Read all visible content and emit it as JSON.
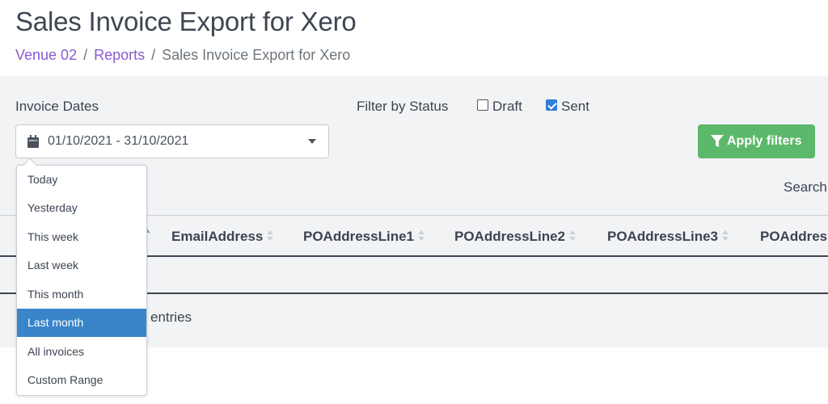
{
  "header": {
    "title": "Sales Invoice Export for Xero",
    "breadcrumb": [
      {
        "label": "Venue 02"
      },
      {
        "label": "Reports"
      },
      {
        "label": "Sales Invoice Export for Xero"
      }
    ],
    "separator": "/"
  },
  "filters": {
    "dates_label": "Invoice Dates",
    "date_range_value": "01/10/2021 - 31/10/2021",
    "status_label": "Filter by Status",
    "draft_label": "Draft",
    "draft_checked": false,
    "sent_label": "Sent",
    "sent_checked": true,
    "apply_label": "Apply filters"
  },
  "search": {
    "label": "Search"
  },
  "table": {
    "columns": [
      "EmailAddress",
      "POAddressLine1",
      "POAddressLine2",
      "POAddressLine3",
      "POAddres"
    ],
    "entries_text": "entries"
  },
  "date_dropdown": {
    "items": [
      "Today",
      "Yesterday",
      "This week",
      "Last week",
      "This month",
      "Last month",
      "All invoices",
      "Custom Range"
    ],
    "selected": "Last month"
  },
  "colors": {
    "link": "#8a5ad0",
    "apply_button": "#5cb86a",
    "selected_item": "#3a85c9",
    "checkbox_checked": "#2f7ed8"
  },
  "icons": {
    "date_input": "calendar-icon",
    "date_toggle": "caret-down-icon",
    "apply": "filter-icon",
    "sort": "sort-icon"
  }
}
